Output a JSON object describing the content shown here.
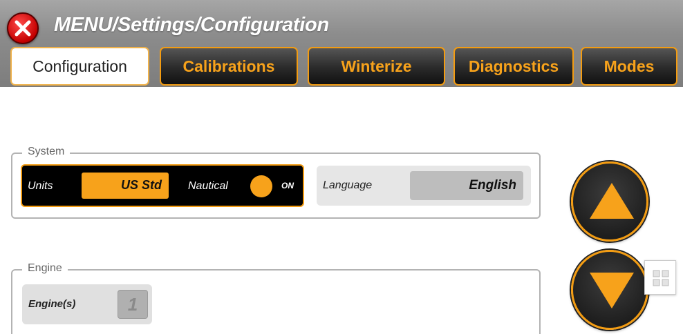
{
  "header": {
    "breadcrumb": "MENU/Settings/Configuration",
    "close_icon": "close-x-icon"
  },
  "tabs": [
    {
      "label": "Configuration",
      "active": true
    },
    {
      "label": "Calibrations",
      "active": false
    },
    {
      "label": "Winterize",
      "active": false
    },
    {
      "label": "Diagnostics",
      "active": false
    },
    {
      "label": "Modes",
      "active": false
    }
  ],
  "system": {
    "group_label": "System",
    "units_label": "Units",
    "units_value": "US Std",
    "nautical_label": "Nautical",
    "nautical_state": "ON",
    "language_label": "Language",
    "language_value": "English"
  },
  "engine": {
    "group_label": "Engine",
    "engines_label": "Engine(s)",
    "engines_value": "1"
  },
  "scroll": {
    "up_icon": "arrow-up-icon",
    "down_icon": "arrow-down-icon"
  },
  "keypad_icon": "keypad-grid-icon",
  "colors": {
    "accent": "#f39c12",
    "close": "#d40000",
    "header": "#8c8c8c"
  }
}
